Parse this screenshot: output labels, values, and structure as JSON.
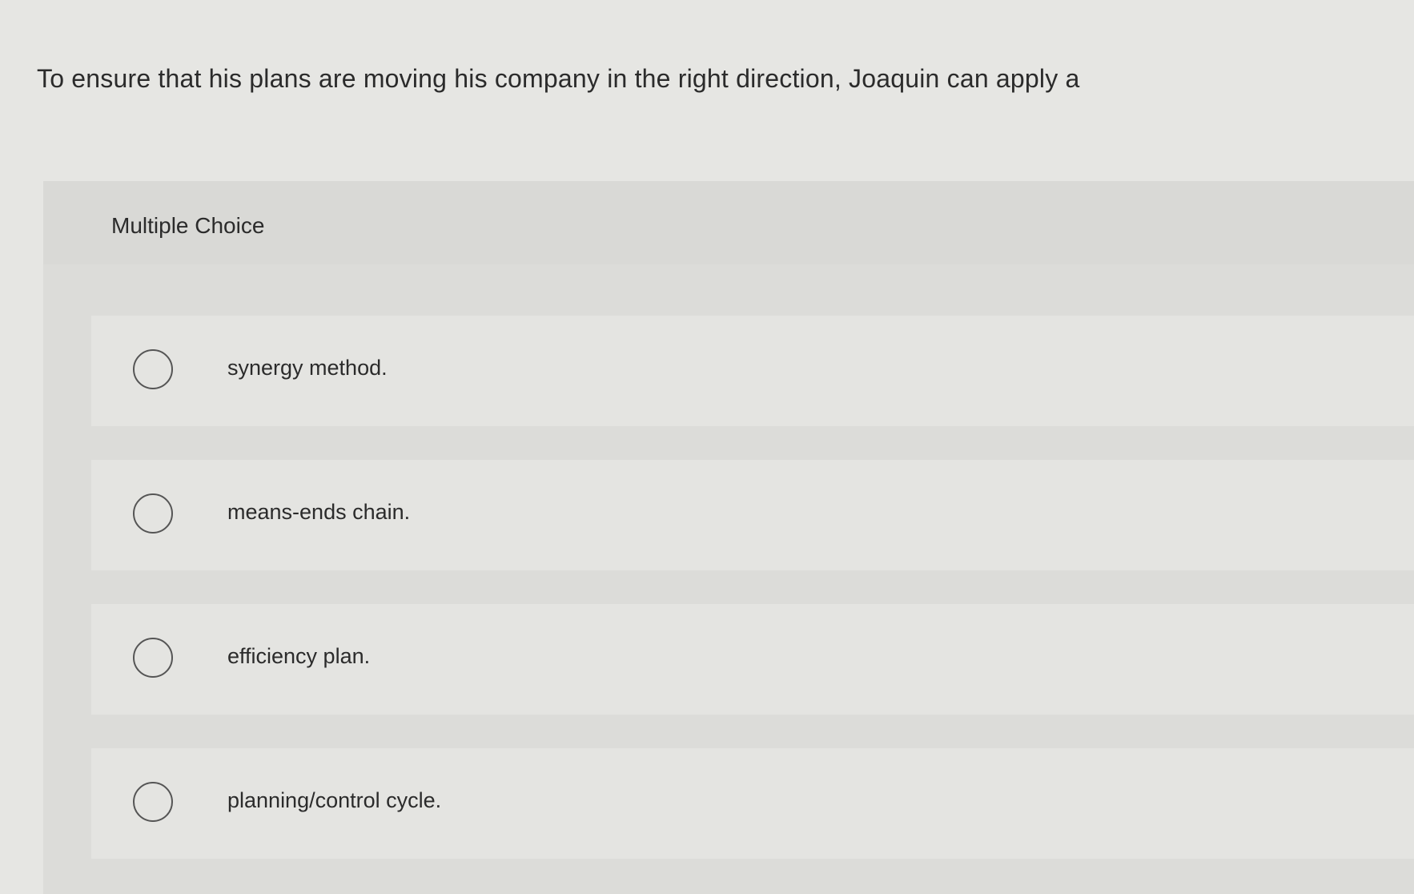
{
  "question": {
    "text": "To ensure that his plans are moving his company in the right direction, Joaquin can apply a"
  },
  "section": {
    "label": "Multiple Choice"
  },
  "choices": [
    {
      "label": "synergy method."
    },
    {
      "label": "means-ends chain."
    },
    {
      "label": "efficiency plan."
    },
    {
      "label": "planning/control cycle."
    }
  ],
  "colors": {
    "background": "#e6e6e3",
    "panel": "#dcdcd9",
    "choice_background": "#e4e4e1",
    "text": "#2b2b2b",
    "radio_border": "#555555"
  }
}
